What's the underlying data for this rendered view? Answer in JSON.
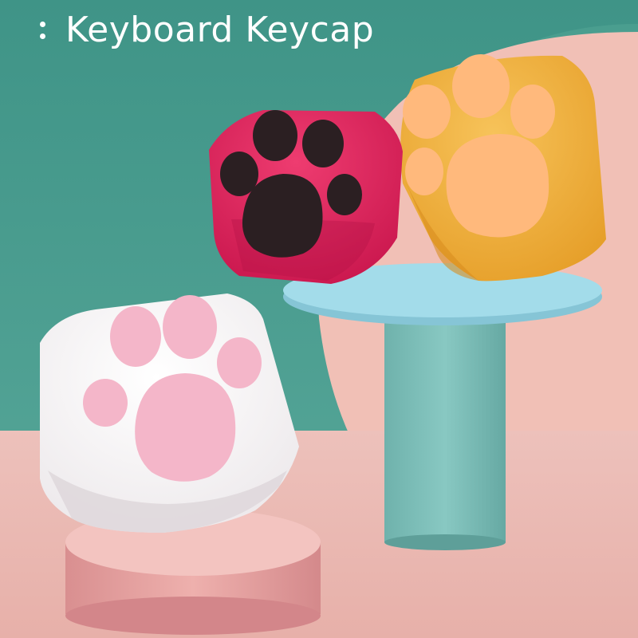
{
  "header": {
    "title": "Keyboard Keycap"
  },
  "scene": {
    "items": [
      {
        "name": "pink-paw-keycap",
        "base_color": "#e51d5b",
        "paw_color": "#2b1f22"
      },
      {
        "name": "orange-paw-keycap",
        "base_color": "#f0ad3c",
        "paw_color": "#ffb97c"
      },
      {
        "name": "white-paw-keycap",
        "base_color": "#f4f1f3",
        "paw_color": "#f4b6c9"
      }
    ],
    "colors": {
      "teal": "#4a998b",
      "peach": "#f3c2b8",
      "pink_floor": "#e9b7b2",
      "blue_stand": "#98d8e6",
      "pink_pedestal": "#e69c9b",
      "white": "#ffffff"
    }
  }
}
